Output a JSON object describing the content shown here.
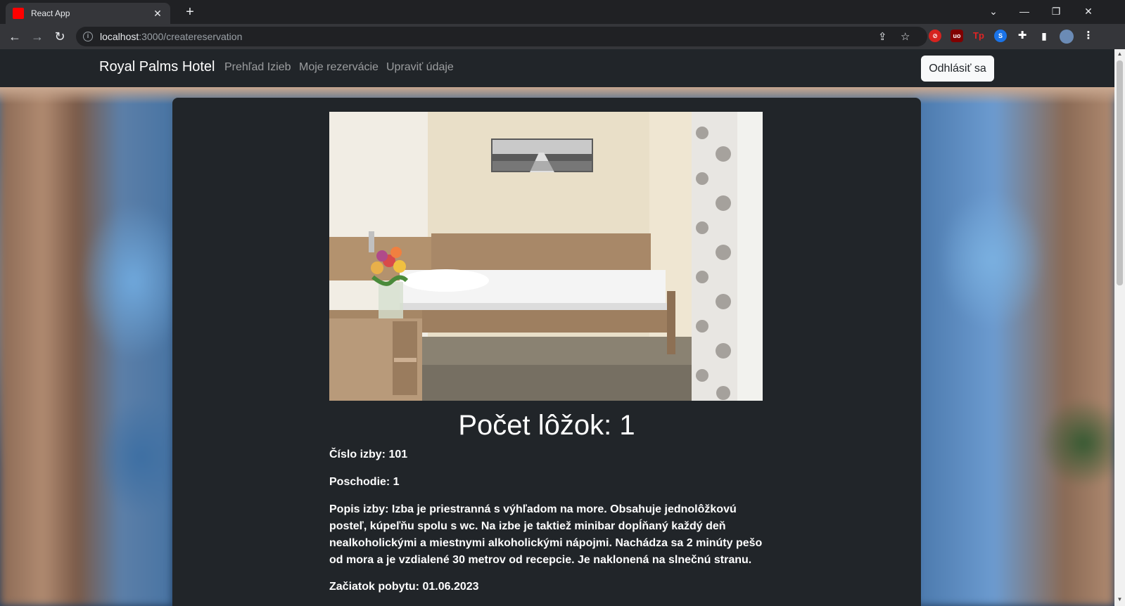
{
  "browser": {
    "tab_title": "React App",
    "url_host": "localhost",
    "url_path": ":3000/createreservation",
    "brand_color": "#ff0000"
  },
  "navbar": {
    "brand": "Royal Palms Hotel",
    "links": [
      "Prehľad Izieb",
      "Moje rezervácie",
      "Upraviť údaje"
    ],
    "logout_label": "Odhlásiť sa"
  },
  "room": {
    "heading": "Počet lôžok: 1",
    "room_number": "Číslo izby: 101",
    "floor": "Poschodie: 1",
    "description": "Popis izby: Izba je priestranná s výhľadom na more. Obsahuje jednolôžkovú posteľ, kúpeľňu spolu s wc. Na izbe je taktiež minibar dopĺňaný každý deň nealkoholickými a miestnymi alkoholickými nápojmi. Nachádza sa 2 minúty pešo od mora a je vzdialené 30 metrov od recepcie. Je naklonená na slnečnú stranu.",
    "stay_start": "Začiatok pobytu: 01.06.2023"
  }
}
